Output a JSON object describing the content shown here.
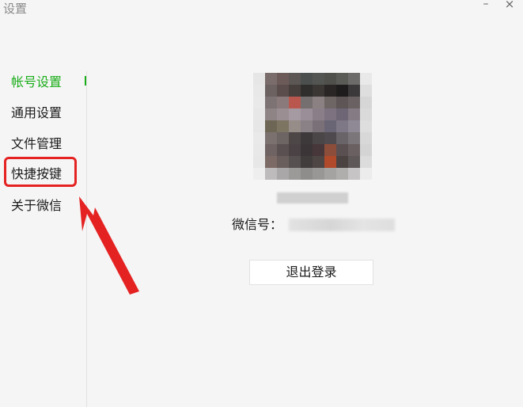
{
  "window": {
    "title": "设置",
    "minimize_glyph": "–",
    "close_glyph": "×"
  },
  "sidebar": {
    "items": [
      {
        "label": "帐号设置",
        "active": true
      },
      {
        "label": "通用设置",
        "active": false
      },
      {
        "label": "文件管理",
        "active": false
      },
      {
        "label": "快捷按键",
        "active": false
      },
      {
        "label": "关于微信",
        "active": false
      }
    ]
  },
  "account": {
    "wxid_label": "微信号：",
    "logout_label": "退出登录"
  },
  "colors": {
    "accent": "#1aad19",
    "annotation": "#e52222"
  }
}
